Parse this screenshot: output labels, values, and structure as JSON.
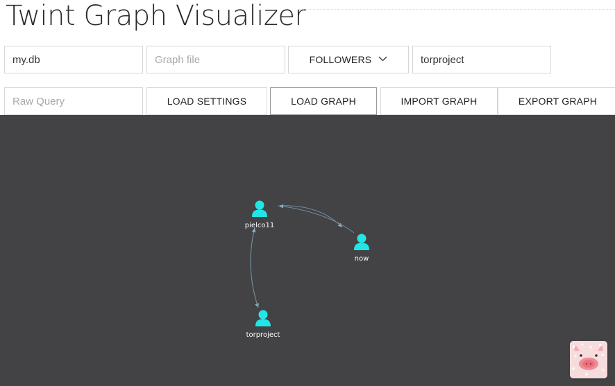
{
  "app": {
    "title": "Twint Graph Visualizer"
  },
  "toolbar_row1": {
    "db_input_value": "my.db",
    "graph_file_placeholder": "Graph file",
    "mode_select_value": "FOLLOWERS",
    "username_input_value": "torproject"
  },
  "toolbar_row2": {
    "raw_query_placeholder": "Raw Query",
    "load_settings_label": "LOAD SETTINGS",
    "load_graph_label": "LOAD GRAPH",
    "import_graph_label": "IMPORT GRAPH",
    "export_graph_label": "EXPORT GRAPH"
  },
  "graph": {
    "background_color": "#434244",
    "node_color": "#22e6e6",
    "edge_color": "#6f8ea0",
    "nodes": [
      {
        "id": "pielco11",
        "label": "pielco11",
        "icon": "user-icon"
      },
      {
        "id": "now",
        "label": "now",
        "icon": "user-icon"
      },
      {
        "id": "torproject",
        "label": "torproject",
        "icon": "user-icon"
      }
    ],
    "edges": [
      {
        "from": "pielco11",
        "to": "now"
      },
      {
        "from": "now",
        "to": "pielco11"
      },
      {
        "from": "pielco11",
        "to": "torproject"
      },
      {
        "from": "torproject",
        "to": "pielco11"
      }
    ]
  },
  "mascot": {
    "icon": "pig-mascot-icon"
  }
}
